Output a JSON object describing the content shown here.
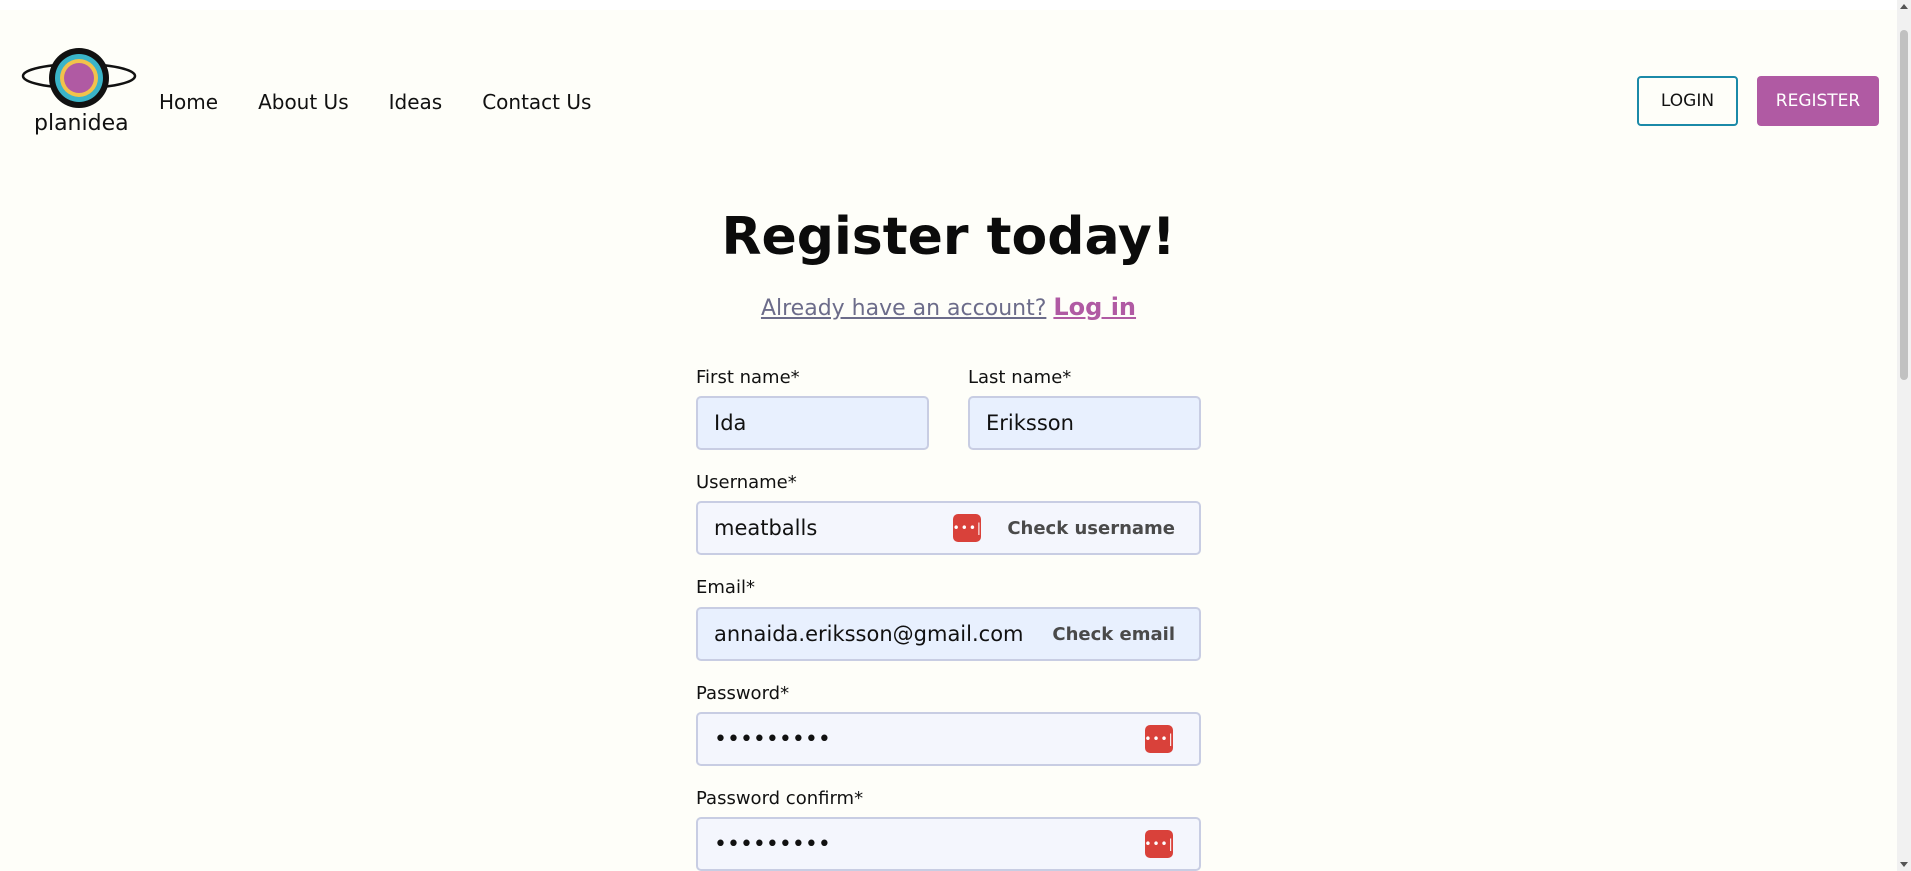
{
  "header": {
    "logo_text": "planidea",
    "nav": [
      {
        "label": "Home"
      },
      {
        "label": "About Us"
      },
      {
        "label": "Ideas"
      },
      {
        "label": "Contact Us"
      }
    ],
    "login_label": "LOGIN",
    "register_label": "REGISTER"
  },
  "main": {
    "title": "Register today!",
    "subtitle_text": "Already have an account?",
    "subtitle_link": "Log in"
  },
  "form": {
    "first_name": {
      "label": "First name*",
      "value": "Ida"
    },
    "last_name": {
      "label": "Last name*",
      "value": "Eriksson"
    },
    "username": {
      "label": "Username*",
      "value": "meatballs",
      "check_label": "Check username"
    },
    "email": {
      "label": "Email*",
      "value": "annaida.eriksson@gmail.com",
      "check_label": "Check email"
    },
    "password": {
      "label": "Password*",
      "value": "•••••••••"
    },
    "password_confirm": {
      "label": "Password confirm*",
      "value": "•••••••••"
    }
  },
  "icons": {
    "password_manager": "password-manager-icon",
    "accent": "#b05aa3",
    "icon_red": "#d9413a"
  }
}
